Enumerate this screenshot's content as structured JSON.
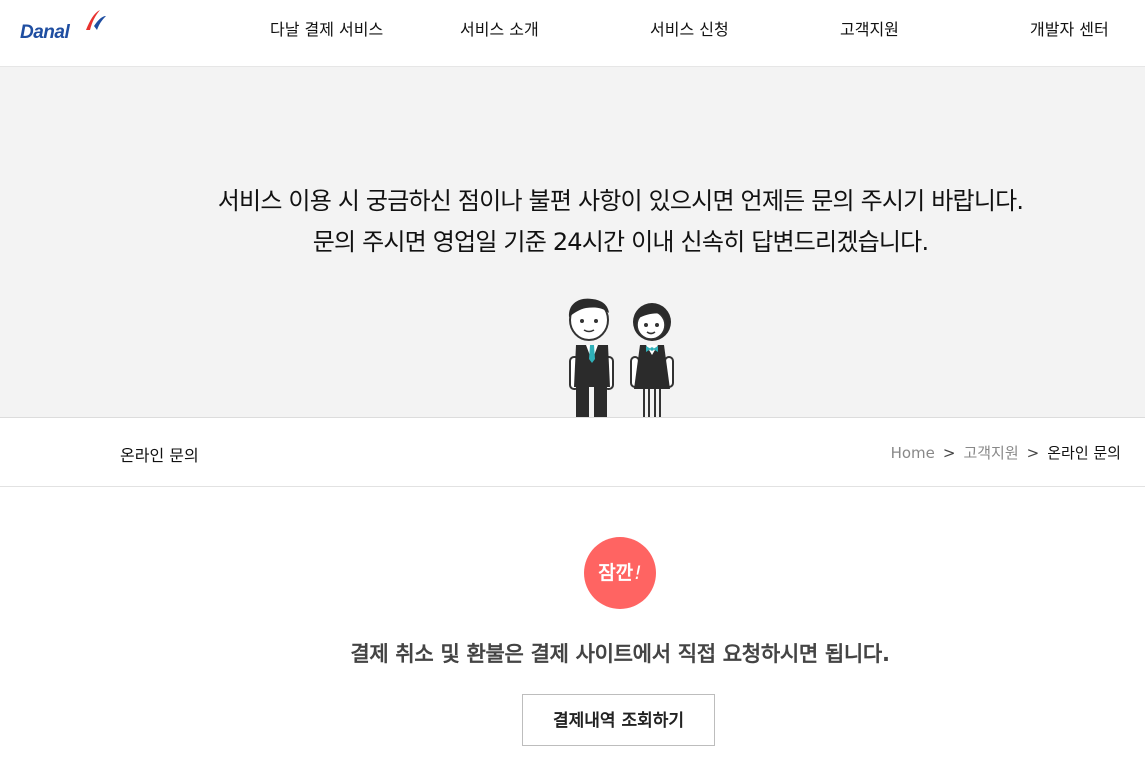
{
  "header": {
    "logo_text": "Danal",
    "nav": [
      "다날 결제 서비스",
      "서비스 소개",
      "서비스 신청",
      "고객지원",
      "개발자 센터"
    ]
  },
  "hero": {
    "line1": "서비스 이용 시 궁금하신 점이나 불편 사항이 있으시면 언제든 문의 주시기 바랍니다.",
    "line2": "문의 주시면 영업일 기준 24시간 이내 신속히 답변드리겠습니다."
  },
  "subbar": {
    "title": "온라인 문의",
    "breadcrumb": [
      "Home",
      "고객지원",
      "온라인 문의"
    ],
    "separator": ">"
  },
  "notice": {
    "badge_text": "잠깐",
    "badge_mark": "!",
    "message": "결제 취소 및 환불은 결제 사이트에서 직접 요청하시면 됩니다.",
    "button_label": "결제내역 조회하기"
  },
  "colors": {
    "brand_blue": "#1f4ea1",
    "brand_red": "#e8322f",
    "badge": "#ff6462",
    "hero_bg": "#f3f3f3",
    "tie": "#2fb0b8"
  }
}
